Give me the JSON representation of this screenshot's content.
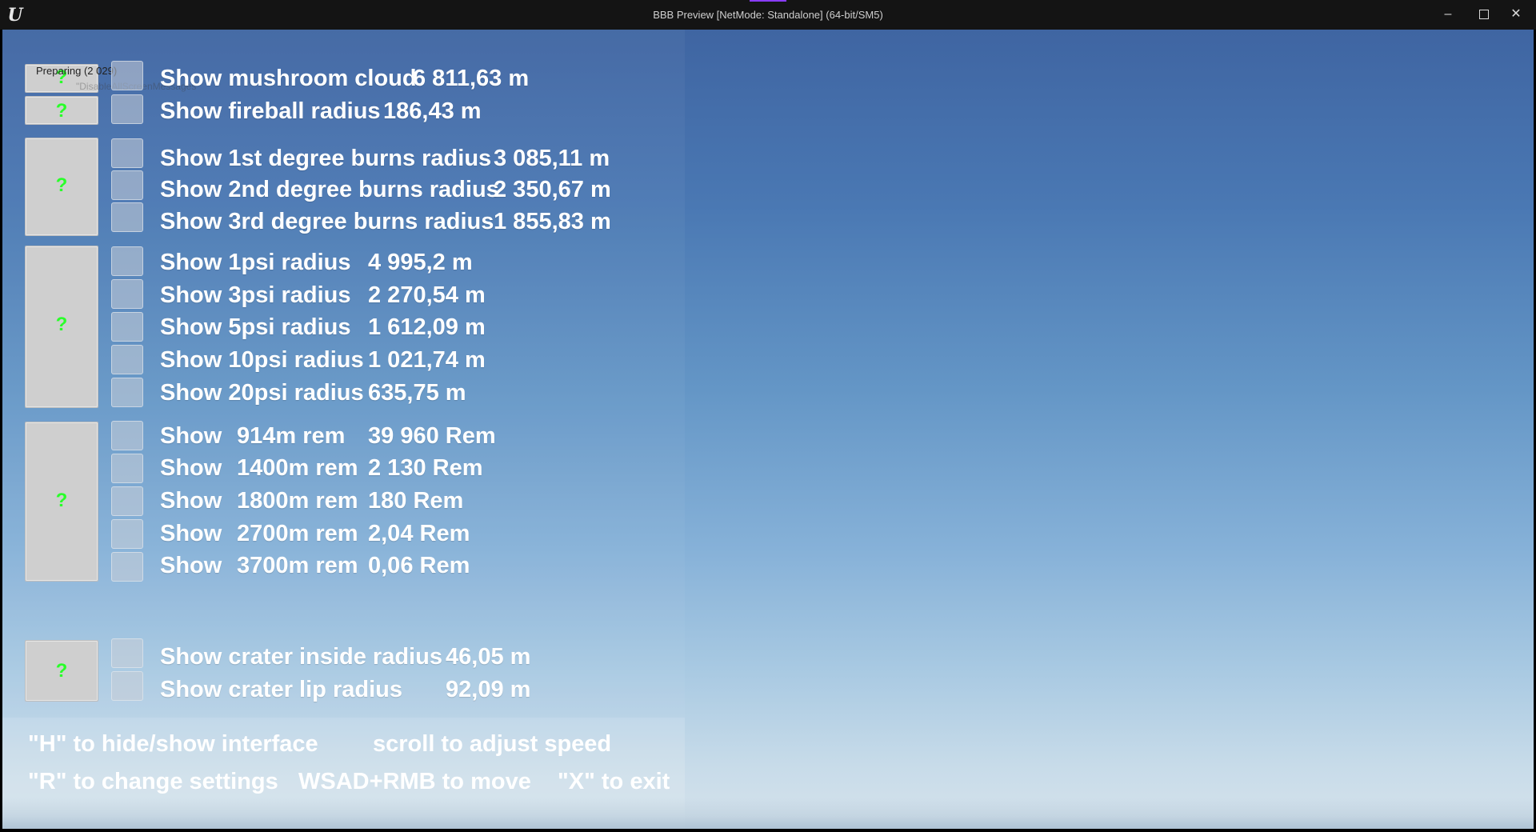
{
  "window": {
    "title": "BBB Preview [NetMode: Standalone]  (64-bit/SM5)",
    "logo": "unreal-engine-logo",
    "controls": {
      "minimize": "–",
      "maximize": "□",
      "close": "✕"
    }
  },
  "status": {
    "preparing": "Preparing (2 029)",
    "disable_hint": "\"DisableAllScreenMessages\""
  },
  "placeholder_mark": "?",
  "groups": {
    "top": [
      {
        "label": "Show mushroom cloud",
        "value": "6 811,63 m"
      },
      {
        "label": "Show fireball radius",
        "value": "186,43 m"
      }
    ],
    "burns": [
      {
        "label": "Show 1st degree burns radius",
        "value": "3 085,11 m"
      },
      {
        "label": "Show 2nd degree burns radius",
        "value": "2 350,67 m"
      },
      {
        "label": "Show 3rd degree burns radius",
        "value": "1 855,83 m"
      }
    ],
    "psi": [
      {
        "label": "Show 1psi radius",
        "value": "4 995,2 m"
      },
      {
        "label": "Show 3psi radius",
        "value": "2 270,54 m"
      },
      {
        "label": "Show 5psi radius",
        "value": "1 612,09 m"
      },
      {
        "label": "Show 10psi radius",
        "value": "1 021,74 m"
      },
      {
        "label": "Show 20psi radius",
        "value": "635,75 m"
      }
    ],
    "rem": [
      {
        "label": "Show",
        "dist": "914m rem",
        "value": "39 960 Rem"
      },
      {
        "label": "Show",
        "dist": "1400m rem",
        "value": "2 130 Rem"
      },
      {
        "label": "Show",
        "dist": "1800m rem",
        "value": "180 Rem"
      },
      {
        "label": "Show",
        "dist": "2700m rem",
        "value": "2,04 Rem"
      },
      {
        "label": "Show",
        "dist": "3700m rem",
        "value": "0,06 Rem"
      }
    ],
    "crater": [
      {
        "label": "Show crater inside radius",
        "value": "46,05 m"
      },
      {
        "label": "Show crater lip radius",
        "value": "92,09 m"
      }
    ]
  },
  "help": {
    "hide": "\"H\" to hide/show interface",
    "scroll": "scroll to adjust speed",
    "settings": "\"R\" to change settings",
    "move": "WSAD+RMB to move",
    "exit": "\"X\" to exit"
  }
}
